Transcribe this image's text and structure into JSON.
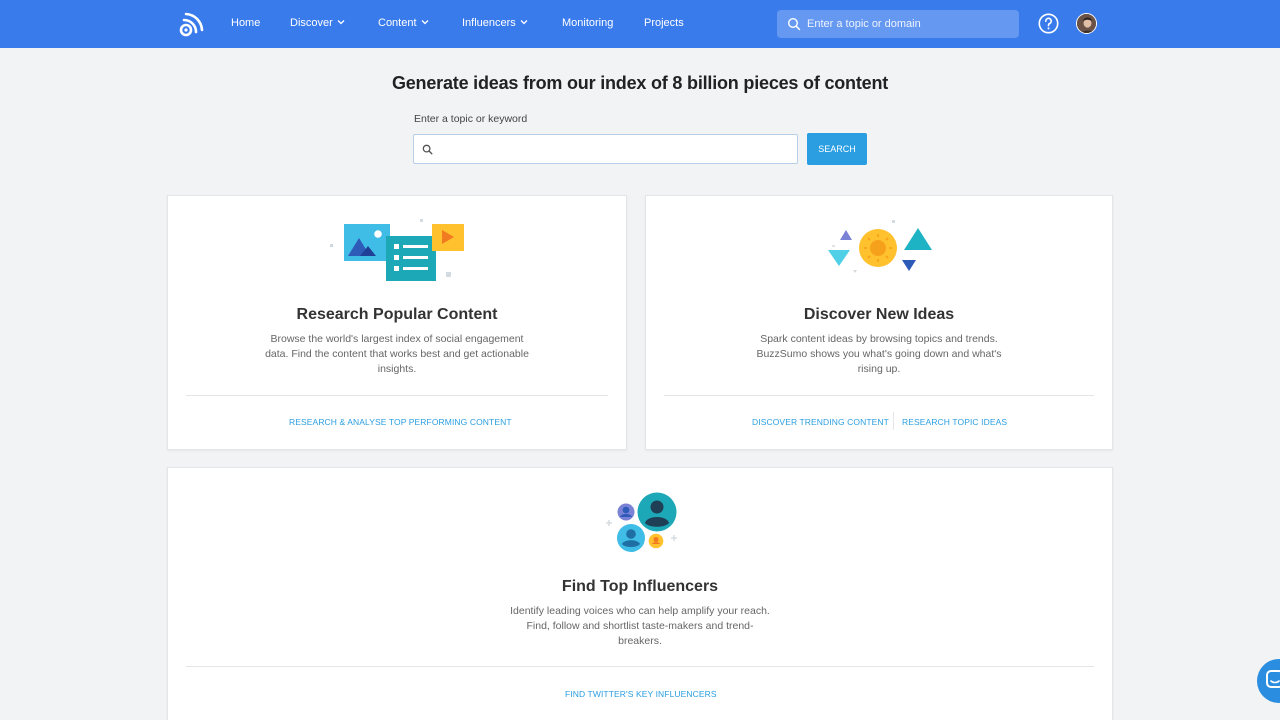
{
  "nav": {
    "items": [
      {
        "label": "Home"
      },
      {
        "label": "Discover"
      },
      {
        "label": "Content"
      },
      {
        "label": "Influencers"
      },
      {
        "label": "Monitoring"
      },
      {
        "label": "Projects"
      }
    ],
    "search_placeholder": "Enter a topic or domain"
  },
  "hero": {
    "title": "Generate ideas from our index of 8 billion pieces of content",
    "label": "Enter a topic or keyword",
    "input_value": "",
    "search_label": "SEARCH"
  },
  "cards": {
    "research": {
      "title": "Research Popular Content",
      "description": "Browse the world's largest index of social engagement data. Find the content that works best and get actionable insights.",
      "link": "RESEARCH & ANALYSE TOP PERFORMING CONTENT"
    },
    "discover": {
      "title": "Discover New Ideas",
      "description": "Spark content ideas by browsing topics and trends. BuzzSumo shows you what's going down and what's rising up.",
      "links": [
        "DISCOVER TRENDING CONTENT",
        "RESEARCH TOPIC IDEAS"
      ]
    },
    "influencers": {
      "title": "Find Top Influencers",
      "description": "Identify leading voices who can help amplify your reach. Find, follow and shortlist taste-makers and trend-breakers.",
      "link": "FIND TWITTER'S KEY INFLUENCERS"
    }
  },
  "colors": {
    "nav_bg": "#3a7bec",
    "accent": "#2a9ee1",
    "page_bg": "#f2f3f5"
  },
  "icons": {
    "logo": "buzzsumo-logo-icon",
    "chevron": "chevron-down-icon",
    "search": "search-icon",
    "help": "help-circle-icon",
    "chat": "chat-icon"
  }
}
